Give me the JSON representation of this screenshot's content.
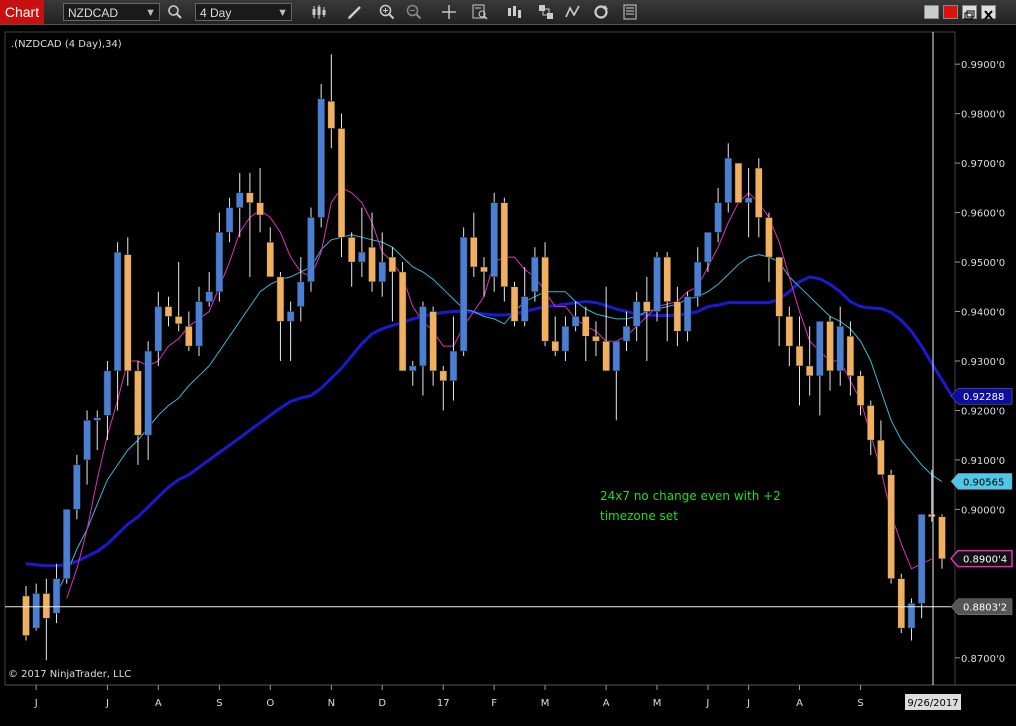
{
  "toolbar": {
    "tab_label": "Chart",
    "instrument": "NZDCAD",
    "period": "4 Day",
    "icons": [
      "search-icon",
      "candlestick-style-icon",
      "draw-pencil-icon",
      "zoom-in-icon",
      "zoom-out-icon",
      "crosshair-icon",
      "data-box-icon",
      "bar-type-icon",
      "strategy-icon",
      "indicators-icon",
      "reload-icon",
      "properties-icon"
    ],
    "window_buttons": [
      "minimize",
      "color",
      "restore",
      "close"
    ]
  },
  "chart": {
    "series_label": ".(NZDCAD (4 Day),34)",
    "copyright": "© 2017 NinjaTrader, LLC",
    "annotation_line1": "24x7 no change even with +2",
    "annotation_line2": "timezone set",
    "annotation_color": "#22dd22",
    "background": "#000000",
    "up_color": "#4a7fd4",
    "down_color": "#f0b060",
    "cursor_date": "9/26/2017",
    "price_markers": [
      {
        "label": "0.92288",
        "value": 0.92288,
        "bg": "#0d0d9e",
        "fg": "#ffffff"
      },
      {
        "label": "0.90565",
        "value": 0.90565,
        "bg": "#4fc8e8",
        "fg": "#000000"
      },
      {
        "label": "0.8900'4",
        "value": 0.89004,
        "bg": "#111111",
        "fg": "#ffffff",
        "border": "#e030c0"
      },
      {
        "label": "0.8803'2",
        "value": 0.88032,
        "bg": "#555555",
        "fg": "#ffffff"
      }
    ],
    "crosshair_price": 0.88032
  },
  "chart_data": {
    "type": "candlestick",
    "ylim": [
      0.8645,
      0.9965
    ],
    "y_ticks": [
      "0.9900'0",
      "0.9800'0",
      "0.9700'0",
      "0.9600'0",
      "0.9500'0",
      "0.9400'0",
      "0.9300'0",
      "0.9200'0",
      "0.9100'0",
      "0.9000'0",
      "0.8900'0",
      "0.8800'0",
      "0.8700'0"
    ],
    "y_tick_values": [
      0.99,
      0.98,
      0.97,
      0.96,
      0.95,
      0.94,
      0.93,
      0.92,
      0.91,
      0.9,
      0.89,
      0.88,
      0.87
    ],
    "x_labels": [
      "J",
      "J",
      "A",
      "S",
      "O",
      "N",
      "D",
      "17",
      "F",
      "M",
      "A",
      "M",
      "J",
      "J",
      "A",
      "S"
    ],
    "x_label_bar_index": [
      1,
      8,
      13,
      19,
      24,
      30,
      35,
      41,
      46,
      51,
      57,
      62,
      67,
      71,
      76,
      82
    ],
    "candles": [
      [
        0.8825,
        0.8845,
        0.8735,
        0.8745
      ],
      [
        0.876,
        0.885,
        0.8755,
        0.883
      ],
      [
        0.883,
        0.886,
        0.8695,
        0.878
      ],
      [
        0.879,
        0.889,
        0.877,
        0.886
      ],
      [
        0.886,
        0.899,
        0.885,
        0.9
      ],
      [
        0.9,
        0.911,
        0.898,
        0.909
      ],
      [
        0.91,
        0.92,
        0.905,
        0.918
      ],
      [
        0.918,
        0.92,
        0.912,
        0.9185
      ],
      [
        0.919,
        0.93,
        0.914,
        0.928
      ],
      [
        0.928,
        0.954,
        0.92,
        0.952
      ],
      [
        0.9515,
        0.955,
        0.925,
        0.928
      ],
      [
        0.928,
        0.93,
        0.909,
        0.915
      ],
      [
        0.915,
        0.934,
        0.91,
        0.932
      ],
      [
        0.932,
        0.944,
        0.929,
        0.941
      ],
      [
        0.941,
        0.943,
        0.937,
        0.939
      ],
      [
        0.939,
        0.95,
        0.936,
        0.9375
      ],
      [
        0.937,
        0.94,
        0.932,
        0.933
      ],
      [
        0.933,
        0.945,
        0.931,
        0.942
      ],
      [
        0.942,
        0.948,
        0.941,
        0.944
      ],
      [
        0.944,
        0.96,
        0.942,
        0.956
      ],
      [
        0.956,
        0.963,
        0.954,
        0.961
      ],
      [
        0.961,
        0.968,
        0.955,
        0.964
      ],
      [
        0.964,
        0.968,
        0.947,
        0.962
      ],
      [
        0.962,
        0.969,
        0.956,
        0.9595
      ],
      [
        0.954,
        0.957,
        0.947,
        0.947
      ],
      [
        0.947,
        0.948,
        0.93,
        0.938
      ],
      [
        0.938,
        0.942,
        0.93,
        0.94
      ],
      [
        0.941,
        0.951,
        0.938,
        0.946
      ],
      [
        0.946,
        0.961,
        0.944,
        0.959
      ],
      [
        0.959,
        0.986,
        0.957,
        0.983
      ],
      [
        0.9825,
        0.992,
        0.973,
        0.977
      ],
      [
        0.977,
        0.98,
        0.951,
        0.955
      ],
      [
        0.955,
        0.956,
        0.945,
        0.95
      ],
      [
        0.95,
        0.961,
        0.947,
        0.952
      ],
      [
        0.953,
        0.96,
        0.944,
        0.946
      ],
      [
        0.946,
        0.956,
        0.943,
        0.95
      ],
      [
        0.951,
        0.953,
        0.938,
        0.948
      ],
      [
        0.948,
        0.95,
        0.928,
        0.928
      ],
      [
        0.928,
        0.93,
        0.925,
        0.929
      ],
      [
        0.929,
        0.942,
        0.923,
        0.941
      ],
      [
        0.94,
        0.941,
        0.925,
        0.928
      ],
      [
        0.928,
        0.929,
        0.92,
        0.926
      ],
      [
        0.926,
        0.939,
        0.922,
        0.932
      ],
      [
        0.932,
        0.957,
        0.931,
        0.955
      ],
      [
        0.955,
        0.96,
        0.947,
        0.949
      ],
      [
        0.949,
        0.951,
        0.943,
        0.948
      ],
      [
        0.947,
        0.964,
        0.944,
        0.962
      ],
      [
        0.962,
        0.963,
        0.942,
        0.945
      ],
      [
        0.945,
        0.946,
        0.937,
        0.938
      ],
      [
        0.938,
        0.949,
        0.937,
        0.943
      ],
      [
        0.944,
        0.953,
        0.942,
        0.951
      ],
      [
        0.951,
        0.954,
        0.933,
        0.934
      ],
      [
        0.934,
        0.939,
        0.931,
        0.932
      ],
      [
        0.932,
        0.939,
        0.93,
        0.937
      ],
      [
        0.937,
        0.942,
        0.936,
        0.939
      ],
      [
        0.939,
        0.941,
        0.93,
        0.935
      ],
      [
        0.935,
        0.938,
        0.931,
        0.934
      ],
      [
        0.934,
        0.945,
        0.93,
        0.928
      ],
      [
        0.928,
        0.934,
        0.918,
        0.934
      ],
      [
        0.934,
        0.94,
        0.932,
        0.937
      ],
      [
        0.937,
        0.944,
        0.934,
        0.942
      ],
      [
        0.942,
        0.947,
        0.93,
        0.94
      ],
      [
        0.94,
        0.952,
        0.938,
        0.951
      ],
      [
        0.951,
        0.952,
        0.934,
        0.942
      ],
      [
        0.942,
        0.945,
        0.933,
        0.936
      ],
      [
        0.936,
        0.944,
        0.934,
        0.943
      ],
      [
        0.943,
        0.953,
        0.941,
        0.95
      ],
      [
        0.95,
        0.956,
        0.948,
        0.956
      ],
      [
        0.956,
        0.965,
        0.954,
        0.962
      ],
      [
        0.962,
        0.974,
        0.96,
        0.971
      ],
      [
        0.97,
        0.97,
        0.964,
        0.962
      ],
      [
        0.962,
        0.969,
        0.955,
        0.963
      ],
      [
        0.969,
        0.971,
        0.955,
        0.959
      ],
      [
        0.959,
        0.96,
        0.946,
        0.951
      ],
      [
        0.951,
        0.95,
        0.933,
        0.939
      ],
      [
        0.939,
        0.941,
        0.929,
        0.933
      ],
      [
        0.933,
        0.939,
        0.921,
        0.929
      ],
      [
        0.929,
        0.937,
        0.923,
        0.927
      ],
      [
        0.927,
        0.934,
        0.919,
        0.938
      ],
      [
        0.938,
        0.939,
        0.924,
        0.928
      ],
      [
        0.928,
        0.941,
        0.925,
        0.937
      ],
      [
        0.935,
        0.938,
        0.923,
        0.927
      ],
      [
        0.927,
        0.928,
        0.919,
        0.921
      ],
      [
        0.921,
        0.922,
        0.911,
        0.914
      ],
      [
        0.914,
        0.918,
        0.909,
        0.907
      ],
      [
        0.907,
        0.908,
        0.885,
        0.886
      ],
      [
        0.886,
        0.887,
        0.875,
        0.876
      ],
      [
        0.876,
        0.882,
        0.8735,
        0.881
      ],
      [
        0.881,
        0.899,
        0.878,
        0.899
      ],
      [
        0.899,
        0.908,
        0.8975,
        0.8985
      ],
      [
        0.8985,
        0.899,
        0.888,
        0.89
      ]
    ],
    "series": [
      {
        "name": "SMA 34",
        "color": "#1a1ad0",
        "values": [
          0.889,
          0.8888,
          0.8886,
          0.8886,
          0.8888,
          0.8895,
          0.8905,
          0.8915,
          0.893,
          0.895,
          0.897,
          0.8985,
          0.9005,
          0.9025,
          0.9045,
          0.906,
          0.907,
          0.9085,
          0.91,
          0.9115,
          0.913,
          0.9145,
          0.916,
          0.9175,
          0.919,
          0.9205,
          0.9218,
          0.9225,
          0.923,
          0.9245,
          0.9265,
          0.9285,
          0.931,
          0.9335,
          0.9355,
          0.9365,
          0.9372,
          0.9378,
          0.9385,
          0.939,
          0.9395,
          0.9398,
          0.94,
          0.94,
          0.9398,
          0.9395,
          0.9393,
          0.9393,
          0.9395,
          0.94,
          0.9405,
          0.941,
          0.9412,
          0.9415,
          0.9418,
          0.942,
          0.9418,
          0.9412,
          0.9405,
          0.94,
          0.9395,
          0.9393,
          0.9392,
          0.9392,
          0.9393,
          0.9395,
          0.94,
          0.941,
          0.9413,
          0.9418,
          0.9418,
          0.9418,
          0.9418,
          0.9418,
          0.9425,
          0.944,
          0.946,
          0.947,
          0.9466,
          0.9455,
          0.944,
          0.942,
          0.941,
          0.9407,
          0.9406,
          0.9398,
          0.9382,
          0.936,
          0.933,
          0.9295,
          0.9262,
          0.9228
        ]
      },
      {
        "name": "SMA 13",
        "color": "#38b8d8",
        "values": [
          null,
          null,
          null,
          0.883,
          0.887,
          0.892,
          0.896,
          0.901,
          0.906,
          0.909,
          0.912,
          0.914,
          0.9165,
          0.919,
          0.921,
          0.9225,
          0.925,
          0.927,
          0.929,
          0.932,
          0.935,
          0.938,
          0.941,
          0.944,
          0.9455,
          0.9465,
          0.947,
          0.948,
          0.949,
          0.9525,
          0.9545,
          0.955,
          0.9555,
          0.955,
          0.9545,
          0.954,
          0.953,
          0.951,
          0.949,
          0.948,
          0.9465,
          0.9445,
          0.9425,
          0.9405,
          0.94,
          0.939,
          0.9385,
          0.9375,
          0.94,
          0.942,
          0.943,
          0.944,
          0.944,
          0.944,
          0.942,
          0.9405,
          0.9395,
          0.939,
          0.9385,
          0.9385,
          0.939,
          0.94,
          0.9405,
          0.941,
          0.9415,
          0.9425,
          0.943,
          0.944,
          0.9455,
          0.9475,
          0.9495,
          0.951,
          0.9515,
          0.951,
          0.95,
          0.947,
          0.945,
          0.943,
          0.941,
          0.939,
          0.938,
          0.9365,
          0.934,
          0.93,
          0.924,
          0.918,
          0.914,
          0.9115,
          0.909,
          0.907,
          0.9056
        ]
      },
      {
        "name": "SMA 5",
        "color": "#e030c0",
        "values": [
          null,
          null,
          null,
          null,
          0.882,
          0.888,
          0.896,
          0.906,
          0.915,
          0.922,
          0.93,
          0.93,
          0.929,
          0.93,
          0.933,
          0.9345,
          0.937,
          0.9385,
          0.94,
          0.945,
          0.95,
          0.956,
          0.959,
          0.9605,
          0.959,
          0.956,
          0.951,
          0.948,
          0.947,
          0.952,
          0.962,
          0.965,
          0.964,
          0.962,
          0.958,
          0.952,
          0.95,
          0.947,
          0.941,
          0.938,
          0.936,
          0.933,
          0.933,
          0.937,
          0.94,
          0.943,
          0.95,
          0.951,
          0.951,
          0.9485,
          0.947,
          0.944,
          0.941,
          0.941,
          0.9385,
          0.937,
          0.936,
          0.934,
          0.934,
          0.935,
          0.937,
          0.939,
          0.941,
          0.9415,
          0.942,
          0.944,
          0.945,
          0.949,
          0.953,
          0.958,
          0.962,
          0.964,
          0.962,
          0.959,
          0.954,
          0.947,
          0.94,
          0.934,
          0.932,
          0.93,
          0.93,
          0.926,
          0.922,
          0.915,
          0.908,
          0.899,
          0.893,
          0.888,
          0.889,
          0.89
        ]
      }
    ]
  }
}
